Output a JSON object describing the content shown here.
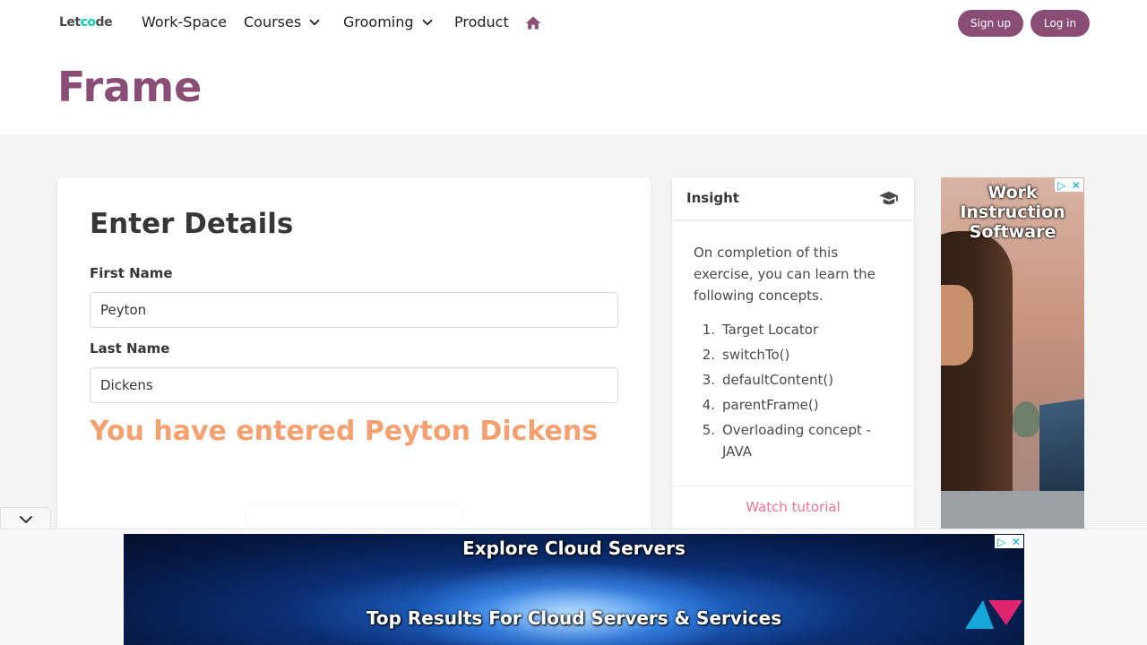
{
  "nav": {
    "logo_part1": "Let",
    "logo_part2": "c",
    "logo_part3": "o",
    "logo_part4": "de",
    "items": [
      {
        "label": "Work-Space"
      },
      {
        "label": "Courses"
      },
      {
        "label": "Grooming"
      },
      {
        "label": "Product"
      }
    ],
    "signup_label": "Sign up",
    "login_label": "Log in",
    "icons": {
      "home": "home-icon",
      "dropdown": "chevron-down-icon"
    }
  },
  "hero": {
    "title": "Frame"
  },
  "form": {
    "title": "Enter Details",
    "first_name_label": "First Name",
    "first_name_value": "Peyton",
    "last_name_label": "Last Name",
    "last_name_value": "Dickens",
    "result_text": "You have entered Peyton Dickens"
  },
  "insight": {
    "title": "Insight",
    "icon": "graduation-cap-icon",
    "description": "On completion of this exercise, you can learn the following concepts.",
    "concepts": [
      {
        "num": "1.",
        "text": "Target Locator"
      },
      {
        "num": "2.",
        "text": "switchTo()"
      },
      {
        "num": "3.",
        "text": "defaultContent()"
      },
      {
        "num": "4.",
        "text": "parentFrame()"
      },
      {
        "num": "5.",
        "text": "Overloading concept - JAVA"
      }
    ],
    "tutorial_link": "Watch tutorial"
  },
  "side_ad": {
    "line1": "Work",
    "line2": "Instruction",
    "line3": "Software"
  },
  "bottom_ad": {
    "line1": "Explore Cloud Servers",
    "line2": "Top Results For Cloud Servers & Services"
  },
  "colors": {
    "brand": "#8a4d76",
    "result": "#f5a06e",
    "link": "#f37291",
    "background": "#f4f4f4"
  }
}
